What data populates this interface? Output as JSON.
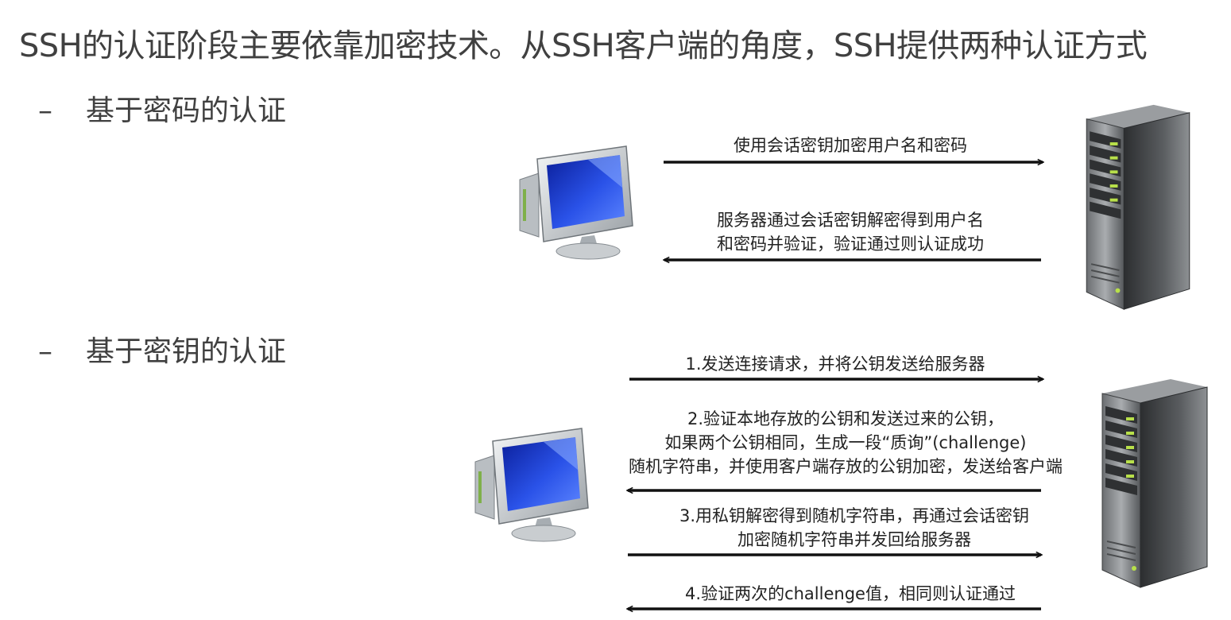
{
  "title": "SSH的认证阶段主要依靠加密技术。从SSH客户端的角度，SSH提供两种认证方式",
  "bullets": [
    {
      "dash": "–",
      "text": "基于密码的认证"
    },
    {
      "dash": "–",
      "text": "基于密钥的认证"
    }
  ],
  "password_auth": {
    "steps": [
      {
        "direction": "to-server",
        "lines": [
          "使用会话密钥加密用户名和密码"
        ]
      },
      {
        "direction": "to-client",
        "lines": [
          "服务器通过会话密钥解密得到用户名",
          "和密码并验证，验证通过则认证成功"
        ]
      }
    ]
  },
  "key_auth": {
    "steps": [
      {
        "direction": "to-server",
        "lines": [
          "1.发送连接请求，并将公钥发送给服务器"
        ]
      },
      {
        "direction": "to-client",
        "lines": [
          "2.验证本地存放的公钥和发送过来的公钥，",
          "如果两个公钥相同，生成一段“质询”(challenge)",
          "随机字符串，并使用客户端存放的公钥加密，发送给客户端"
        ]
      },
      {
        "direction": "to-server",
        "lines": [
          "3.用私钥解密得到随机字符串，再通过会话密钥",
          "加密随机字符串并发回给服务器"
        ]
      },
      {
        "direction": "to-client",
        "lines": [
          "4.验证两次的challenge值，相同则认证通过"
        ]
      }
    ]
  },
  "colors": {
    "screen_blue": "#1f3fd1",
    "monitor_gray": "#cfd3d6",
    "server_dark": "#3c3e40",
    "server_led": "#b8e04a"
  }
}
